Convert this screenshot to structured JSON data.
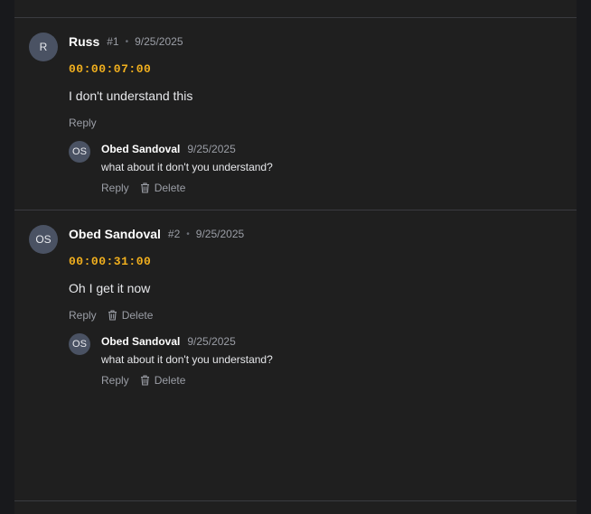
{
  "comments": [
    {
      "avatar_initials": "R",
      "author": "Russ",
      "number": "#1",
      "separator": "•",
      "date": "9/25/2025",
      "timecode": "00:00:07:00",
      "text": "I don't understand this",
      "reply_label": "Reply",
      "reply": {
        "avatar_initials": "OS",
        "author": "Obed Sandoval",
        "date": "9/25/2025",
        "text": "what about it don't you understand?",
        "reply_label": "Reply",
        "delete_label": "Delete"
      }
    },
    {
      "avatar_initials": "OS",
      "author": "Obed Sandoval",
      "number": "#2",
      "separator": "•",
      "date": "9/25/2025",
      "timecode": "00:00:31:00",
      "text": "Oh I get it now",
      "reply_label": "Reply",
      "delete_label": "Delete",
      "reply": {
        "avatar_initials": "OS",
        "author": "Obed Sandoval",
        "date": "9/25/2025",
        "text": "what about it don't you understand?",
        "reply_label": "Reply",
        "delete_label": "Delete"
      }
    }
  ],
  "icons": {
    "delete": "trash-icon"
  },
  "colors": {
    "timecode": "#f2b01e",
    "avatar": "#4a5263",
    "panel": "#1f1f1f"
  }
}
